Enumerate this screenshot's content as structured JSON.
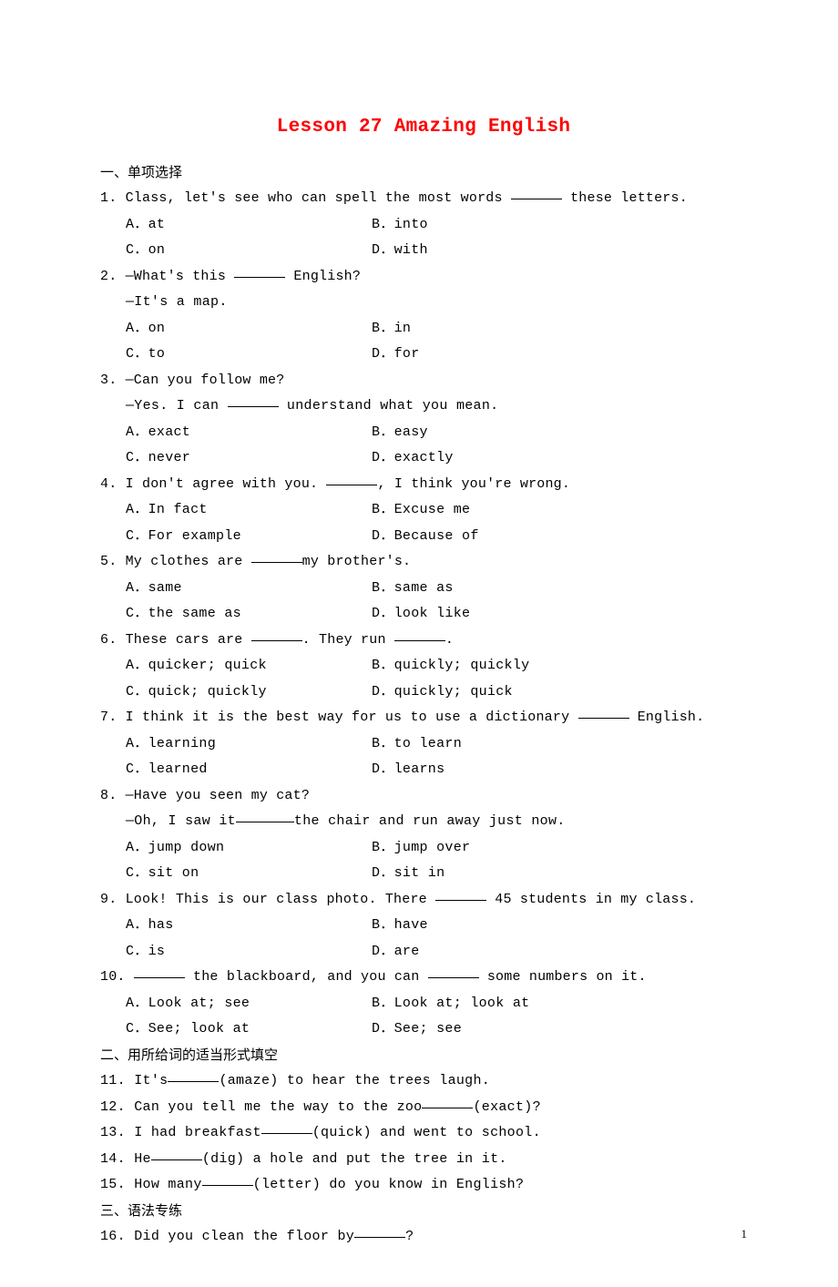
{
  "title_lesson": "Lesson 27 Amazing",
  "title_suffix": " English",
  "page_number": "1",
  "sections": {
    "s1": "一、单项选择",
    "s2": "二、用所给词的适当形式填空",
    "s3": "三、语法专练"
  },
  "q1": {
    "num": "1.",
    "stem_a": "Class, let's see who can spell the most words ",
    "stem_b": " these letters.",
    "A": "A．at",
    "B": "B．into",
    "C": "C．on",
    "D": "D．with"
  },
  "q2": {
    "num": "2.",
    "stem_a": "—What's this ",
    "stem_b": " English?",
    "sub": "—It's a map.",
    "A": "A．on",
    "B": "B．in",
    "C": "C．to",
    "D": "D．for"
  },
  "q3": {
    "num": "3.",
    "stem": "—Can you follow me?",
    "sub_a": "—Yes. I can ",
    "sub_b": " understand what you mean.",
    "A": "A．exact",
    "B": "B．easy",
    "C": "C．never",
    "D": "D．exactly"
  },
  "q4": {
    "num": "4.",
    "stem_a": "I don't agree with you. ",
    "stem_b": ", I think you're wrong.",
    "A": "A．In fact",
    "B": "B．Excuse me",
    "C": "C．For example",
    "D": "D．Because of"
  },
  "q5": {
    "num": "5.",
    "stem_a": "My clothes are ",
    "stem_b": "my brother's.",
    "A": "A．same",
    "B": "B．same as",
    "C": "C．the same as",
    "D": "D．look like"
  },
  "q6": {
    "num": "6.",
    "stem_a": "These cars are ",
    "stem_b": ". They run ",
    "stem_c": ".",
    "A": "A．quicker; quick",
    "B": "B．quickly; quickly",
    "C": "C．quick; quickly",
    "D": "D．quickly; quick"
  },
  "q7": {
    "num": "7.",
    "stem_a": "I think it is the best way for us to use a dictionary ",
    "stem_b": " English.",
    "A": "A．learning",
    "B": "B．to learn",
    "C": "C．learned",
    "D": "D．learns"
  },
  "q8": {
    "num": "8.",
    "stem": "—Have you seen my cat?",
    "sub_a": "—Oh, I saw it",
    "sub_b": "the chair and run away just now.",
    "A": "A．jump down",
    "B": "B．jump over",
    "C": "C．sit on",
    "D": "D．sit in"
  },
  "q9": {
    "num": "9.",
    "stem_a": "Look! This is our class photo. There ",
    "stem_b": " 45 students in my class.",
    "A": "A．has",
    "B": "B．have",
    "C": "C．is",
    "D": "D．are"
  },
  "q10": {
    "num": "10.",
    "stem_a": " the blackboard, and you can ",
    "stem_b": " some numbers on it.",
    "A": "A．Look at; see",
    "B": "B．Look at; look at",
    "C": "C．See; look at",
    "D": "D．See; see"
  },
  "q11": {
    "num": "11.",
    "a": "It's",
    "b": "(amaze) to hear the trees laugh."
  },
  "q12": {
    "num": "12.",
    "a": "Can you tell me the way to the zoo",
    "b": "(exact)?"
  },
  "q13": {
    "num": "13.",
    "a": "I had breakfast",
    "b": "(quick) and went to school."
  },
  "q14": {
    "num": "14.",
    "a": "He",
    "b": "(dig) a hole and put the tree in it."
  },
  "q15": {
    "num": "15.",
    "a": "How many",
    "b": "(letter) do you know in English?"
  },
  "q16": {
    "num": "16.",
    "a": "Did you clean the floor by",
    "b": "?"
  }
}
